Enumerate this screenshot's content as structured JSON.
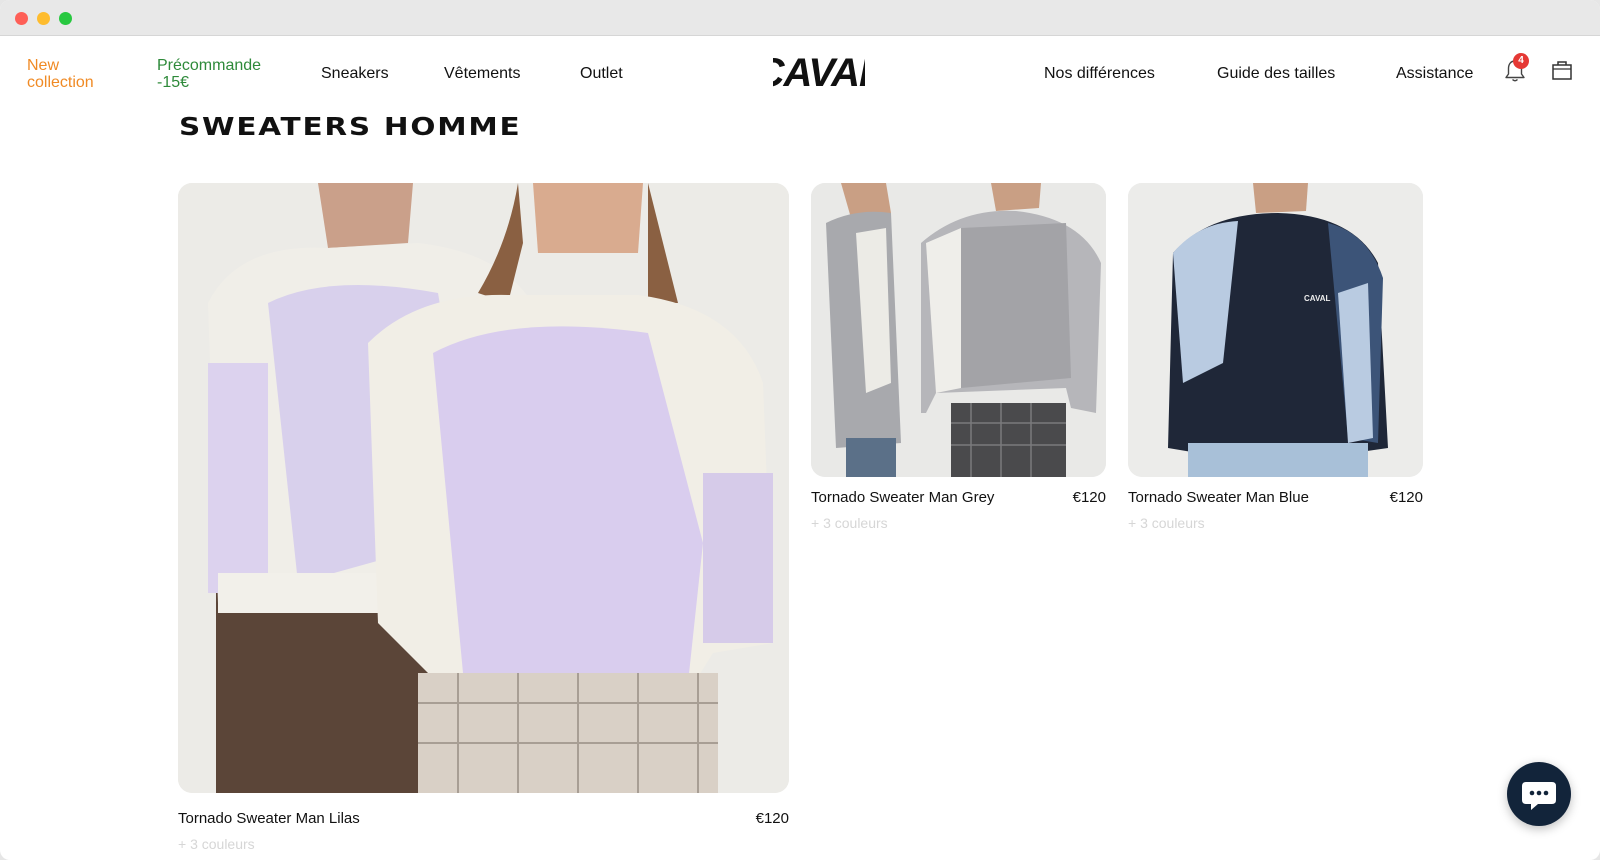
{
  "nav": {
    "new_collection": "New collection",
    "precommande": "Précommande -15€",
    "sneakers": "Sneakers",
    "vetements": "Vêtements",
    "outlet": "Outlet",
    "nos_differences": "Nos différences",
    "guide_tailles": "Guide des tailles",
    "assistance": "Assistance",
    "notification_count": "4",
    "logo_text": "CAVAL",
    "new_color": "#f08a24",
    "pre_color": "#2e8a3a"
  },
  "page": {
    "title": "SWEATERS HOMME"
  },
  "products": [
    {
      "name": "Tornado Sweater Man Lilas",
      "price": "€120",
      "colors": "+ 3 couleurs",
      "swatch": "#d9cdee"
    },
    {
      "name": "Tornado Sweater Man Grey",
      "price": "€120",
      "colors": "+ 3 couleurs",
      "swatch": "#a9a9ac"
    },
    {
      "name": "Tornado Sweater Man Blue",
      "price": "€120",
      "colors": "+ 3 couleurs",
      "swatch": "#1e2637"
    }
  ],
  "chat": {
    "icon": "chat-bubble-icon"
  }
}
